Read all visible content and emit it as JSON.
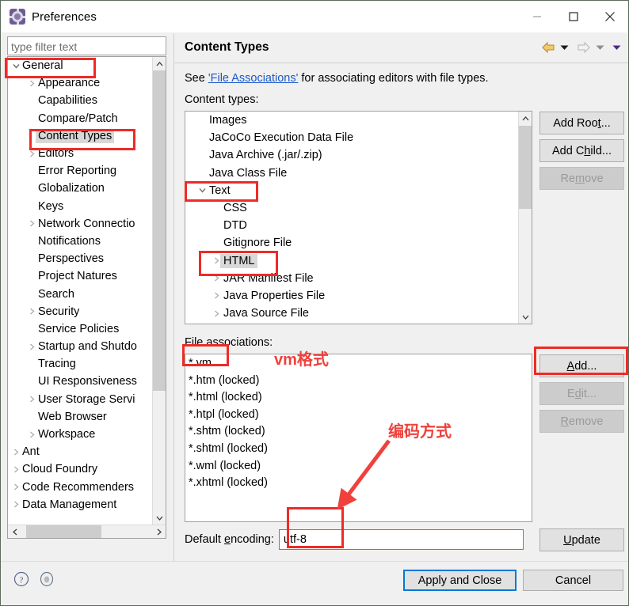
{
  "window": {
    "title": "Preferences",
    "icon": "gear-icon",
    "controls": {
      "minimize": "minimize-icon",
      "maximize": "maximize-icon",
      "close": "close-icon"
    }
  },
  "sidebar": {
    "filter_placeholder": "type filter text",
    "filter_value": "",
    "items": [
      {
        "label": "General",
        "depth": 0,
        "twisty": "expanded",
        "selected": false
      },
      {
        "label": "Appearance",
        "depth": 1,
        "twisty": "collapsed",
        "selected": false
      },
      {
        "label": "Capabilities",
        "depth": 1,
        "twisty": "none",
        "selected": false
      },
      {
        "label": "Compare/Patch",
        "depth": 1,
        "twisty": "none",
        "selected": false
      },
      {
        "label": "Content Types",
        "depth": 1,
        "twisty": "none",
        "selected": true
      },
      {
        "label": "Editors",
        "depth": 1,
        "twisty": "collapsed",
        "selected": false
      },
      {
        "label": "Error Reporting",
        "depth": 1,
        "twisty": "none",
        "selected": false
      },
      {
        "label": "Globalization",
        "depth": 1,
        "twisty": "none",
        "selected": false
      },
      {
        "label": "Keys",
        "depth": 1,
        "twisty": "none",
        "selected": false
      },
      {
        "label": "Network Connectio",
        "depth": 1,
        "twisty": "collapsed",
        "selected": false
      },
      {
        "label": "Notifications",
        "depth": 1,
        "twisty": "none",
        "selected": false
      },
      {
        "label": "Perspectives",
        "depth": 1,
        "twisty": "none",
        "selected": false
      },
      {
        "label": "Project Natures",
        "depth": 1,
        "twisty": "none",
        "selected": false
      },
      {
        "label": "Search",
        "depth": 1,
        "twisty": "none",
        "selected": false
      },
      {
        "label": "Security",
        "depth": 1,
        "twisty": "collapsed",
        "selected": false
      },
      {
        "label": "Service Policies",
        "depth": 1,
        "twisty": "none",
        "selected": false
      },
      {
        "label": "Startup and Shutdo",
        "depth": 1,
        "twisty": "collapsed",
        "selected": false
      },
      {
        "label": "Tracing",
        "depth": 1,
        "twisty": "none",
        "selected": false
      },
      {
        "label": "UI Responsiveness",
        "depth": 1,
        "twisty": "none",
        "selected": false
      },
      {
        "label": "User Storage Servi",
        "depth": 1,
        "twisty": "collapsed",
        "selected": false
      },
      {
        "label": "Web Browser",
        "depth": 1,
        "twisty": "none",
        "selected": false
      },
      {
        "label": "Workspace",
        "depth": 1,
        "twisty": "collapsed",
        "selected": false
      },
      {
        "label": "Ant",
        "depth": 0,
        "twisty": "collapsed",
        "selected": false
      },
      {
        "label": "Cloud Foundry",
        "depth": 0,
        "twisty": "collapsed",
        "selected": false
      },
      {
        "label": "Code Recommenders",
        "depth": 0,
        "twisty": "collapsed",
        "selected": false
      },
      {
        "label": "Data Management",
        "depth": 0,
        "twisty": "collapsed",
        "selected": false
      }
    ]
  },
  "content": {
    "title": "Content Types",
    "description_prefix": "See ",
    "description_link": "'File Associations'",
    "description_suffix": " for associating editors with file types.",
    "content_types_label": "Content types:",
    "file_associations_label": "File associations:",
    "nav": {
      "back": "back-arrow-icon",
      "back_menu": "dropdown-arrow-icon",
      "forward": "forward-arrow-icon",
      "forward_menu": "dropdown-arrow-icon",
      "view_menu": "view-menu-arrow-icon"
    },
    "content_types": [
      {
        "label": "Images",
        "depth": 0,
        "twisty": "none",
        "selected": false
      },
      {
        "label": "JaCoCo Execution Data File",
        "depth": 0,
        "twisty": "none",
        "selected": false
      },
      {
        "label": "Java Archive (.jar/.zip)",
        "depth": 0,
        "twisty": "none",
        "selected": false
      },
      {
        "label": "Java Class File",
        "depth": 0,
        "twisty": "none",
        "selected": false
      },
      {
        "label": "Text",
        "depth": 0,
        "twisty": "expanded",
        "selected": false
      },
      {
        "label": "CSS",
        "depth": 1,
        "twisty": "none",
        "selected": false
      },
      {
        "label": "DTD",
        "depth": 1,
        "twisty": "none",
        "selected": false
      },
      {
        "label": "Gitignore File",
        "depth": 1,
        "twisty": "none",
        "selected": false
      },
      {
        "label": "HTML",
        "depth": 1,
        "twisty": "collapsed",
        "selected": true
      },
      {
        "label": "JAR Manifest File",
        "depth": 1,
        "twisty": "collapsed",
        "selected": false
      },
      {
        "label": "Java Properties File",
        "depth": 1,
        "twisty": "collapsed",
        "selected": false
      },
      {
        "label": "Java Source File",
        "depth": 1,
        "twisty": "collapsed",
        "selected": false
      }
    ],
    "file_associations": [
      "*.vm",
      "*.htm (locked)",
      "*.html (locked)",
      "*.htpl (locked)",
      "*.shtm (locked)",
      "*.shtml (locked)",
      "*.wml (locked)",
      "*.xhtml (locked)"
    ],
    "encoding_label": "Default encoding:",
    "encoding_value": "utf-8",
    "buttons": {
      "add_root": "Add Root...",
      "add_child": "Add Child...",
      "remove_top": "Remove",
      "add": "Add...",
      "edit": "Edit...",
      "remove_bottom": "Remove",
      "update": "Update"
    }
  },
  "footer": {
    "help_icon": "help-icon",
    "restore_icon": "restore-defaults-icon",
    "apply_and_close": "Apply and Close",
    "cancel": "Cancel"
  },
  "annotations": {
    "vm_format": "vm格式",
    "encoding_method": "编码方式",
    "color": "#ee2b26"
  }
}
